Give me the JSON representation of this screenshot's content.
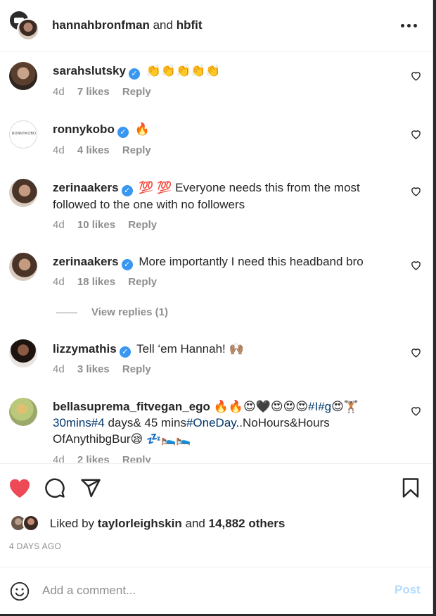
{
  "header": {
    "user1": "hannahbronfman",
    "conjunction": "and",
    "user2": "hbfit"
  },
  "comments": [
    {
      "user": "sarahslutsky",
      "text": "👏👏👏👏👏",
      "age": "4d",
      "likes": "7 likes",
      "reply": "Reply"
    },
    {
      "user": "ronnykobo",
      "text": "🔥",
      "age": "4d",
      "likes": "4 likes",
      "reply": "Reply",
      "avatar_text": "RONNYKOBO"
    },
    {
      "user": "zerinaakers",
      "text": "💯 💯 Everyone needs this from the most followed to the one with no followers",
      "age": "4d",
      "likes": "10 likes",
      "reply": "Reply"
    },
    {
      "user": "zerinaakers",
      "text": "More importantly I need this headband bro",
      "age": "4d",
      "likes": "18 likes",
      "reply": "Reply"
    },
    {
      "user": "lizzymathis",
      "text": "Tell ‘em Hannah! 🙌🏽",
      "age": "4d",
      "likes": "3 likes",
      "reply": "Reply"
    },
    {
      "user": "bellasuprema_fitvegan_ego",
      "text_a": "🔥🔥😍🖤😍😍😍",
      "hashtag1": "#I#g",
      "text_b": "😍🏋🏽 ",
      "hashtag2": "30mins#4",
      "text_c": " days& 45 mins",
      "hashtag3": "#OneDay",
      "text_d": "..NoHours&Hours OfAnythibgBur😪 💤🛌🛌",
      "age": "4d",
      "likes": "2 likes",
      "reply": "Reply"
    }
  ],
  "view_replies": "View replies (1)",
  "liked_by": {
    "prefix": "Liked by",
    "user": "taylorleighskin",
    "and": "and",
    "others": "14,882 others"
  },
  "timestamp": "4 DAYS AGO",
  "add_comment": {
    "placeholder": "Add a comment...",
    "post_label": "Post"
  },
  "colors": {
    "like_red": "#ed4956",
    "verified_blue": "#3897f0",
    "post_disabled": "#b3dbff"
  }
}
